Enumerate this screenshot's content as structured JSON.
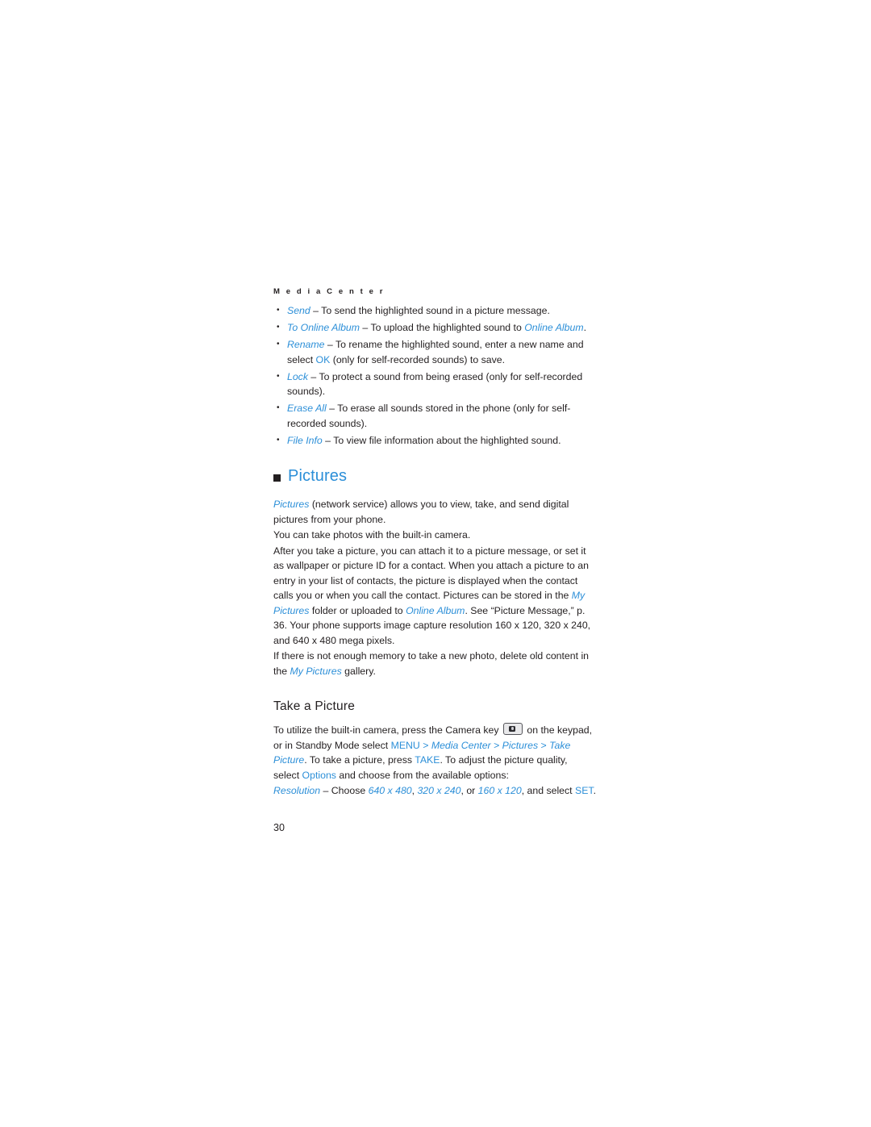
{
  "header": "M e d i a   C e n t e r",
  "bullets": [
    {
      "term": "Send",
      "dash": " – ",
      "rest": "To send the highlighted sound in a picture message."
    },
    {
      "term": "To Online Album",
      "dash": " – ",
      "rest": "To upload the highlighted sound to ",
      "rest_blue": "Online Album",
      "rest_tail": "."
    },
    {
      "term": "Rename",
      "dash": " – ",
      "rest": "To rename the highlighted sound, enter a new name and select ",
      "rest_blue": "OK",
      "rest_tail": " (only for self-recorded sounds) to save."
    },
    {
      "term": "Lock",
      "dash": " – ",
      "rest": "To protect a sound from being erased (only for self-recorded sounds)."
    },
    {
      "term": "Erase All",
      "dash": " – ",
      "rest": "To erase all sounds stored in the phone (only for self-recorded sounds)."
    },
    {
      "term": "File Info",
      "dash": " – ",
      "rest": "To view file information about the highlighted sound."
    }
  ],
  "section_title": "Pictures",
  "para1": {
    "lead": "Pictures",
    "rest": " (network service) allows you to view, take, and send digital pictures from your phone."
  },
  "para2": "You can take photos with the built-in camera.",
  "para3": {
    "a": "After you take a picture, you can attach it to a picture message, or set it as wallpaper or picture ID for a contact. When you attach a picture to an entry in your list of contacts, the picture is displayed when the contact calls you or when you call the contact. Pictures can be stored in the ",
    "b": "My Pictures",
    "c": " folder or uploaded to ",
    "d": "Online Album",
    "e": ". See “Picture Message,” p. 36. Your phone supports image capture resolution 160 x 120, 320 x 240, and 640 x 480 mega pixels."
  },
  "para4": {
    "a": "If there is not enough memory to take a new photo, delete old content in the ",
    "b": "My Pictures",
    "c": " gallery."
  },
  "subsection_title": "Take a Picture",
  "para5": {
    "a": "To utilize the built-in camera, press the Camera key ",
    "icon": "camera-key-icon",
    "b": " on the keypad, or in Standby Mode select ",
    "menu": "MENU",
    "sep1": " > ",
    "media_center": "Media Center",
    "sep2": " > ",
    "pictures": "Pictures",
    "sep3": " > ",
    "take_picture": "Take Picture",
    "c": ". To take a picture, press ",
    "take": "TAKE",
    "d": ". To adjust the picture quality, select ",
    "options": "Options",
    "e": " and choose from the available options:"
  },
  "para6": {
    "term": "Resolution",
    "dash": " – ",
    "a": "Choose ",
    "r1": "640 x 480",
    "sep1": ", ",
    "r2": "320 x 240",
    "sep2": ", or ",
    "r3": "160 x 120",
    "b": ", and select ",
    "set": "SET",
    "c": "."
  },
  "page_number": "30",
  "colors": {
    "accent": "#2c8fd8",
    "text": "#231f20"
  }
}
